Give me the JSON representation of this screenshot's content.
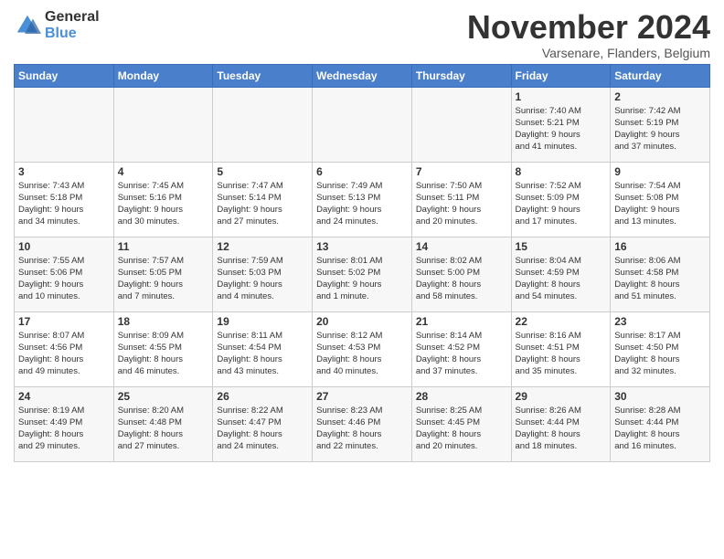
{
  "header": {
    "logo_general": "General",
    "logo_blue": "Blue",
    "title": "November 2024",
    "location": "Varsenare, Flanders, Belgium"
  },
  "days_of_week": [
    "Sunday",
    "Monday",
    "Tuesday",
    "Wednesday",
    "Thursday",
    "Friday",
    "Saturday"
  ],
  "weeks": [
    [
      {
        "day": "",
        "info": ""
      },
      {
        "day": "",
        "info": ""
      },
      {
        "day": "",
        "info": ""
      },
      {
        "day": "",
        "info": ""
      },
      {
        "day": "",
        "info": ""
      },
      {
        "day": "1",
        "info": "Sunrise: 7:40 AM\nSunset: 5:21 PM\nDaylight: 9 hours\nand 41 minutes."
      },
      {
        "day": "2",
        "info": "Sunrise: 7:42 AM\nSunset: 5:19 PM\nDaylight: 9 hours\nand 37 minutes."
      }
    ],
    [
      {
        "day": "3",
        "info": "Sunrise: 7:43 AM\nSunset: 5:18 PM\nDaylight: 9 hours\nand 34 minutes."
      },
      {
        "day": "4",
        "info": "Sunrise: 7:45 AM\nSunset: 5:16 PM\nDaylight: 9 hours\nand 30 minutes."
      },
      {
        "day": "5",
        "info": "Sunrise: 7:47 AM\nSunset: 5:14 PM\nDaylight: 9 hours\nand 27 minutes."
      },
      {
        "day": "6",
        "info": "Sunrise: 7:49 AM\nSunset: 5:13 PM\nDaylight: 9 hours\nand 24 minutes."
      },
      {
        "day": "7",
        "info": "Sunrise: 7:50 AM\nSunset: 5:11 PM\nDaylight: 9 hours\nand 20 minutes."
      },
      {
        "day": "8",
        "info": "Sunrise: 7:52 AM\nSunset: 5:09 PM\nDaylight: 9 hours\nand 17 minutes."
      },
      {
        "day": "9",
        "info": "Sunrise: 7:54 AM\nSunset: 5:08 PM\nDaylight: 9 hours\nand 13 minutes."
      }
    ],
    [
      {
        "day": "10",
        "info": "Sunrise: 7:55 AM\nSunset: 5:06 PM\nDaylight: 9 hours\nand 10 minutes."
      },
      {
        "day": "11",
        "info": "Sunrise: 7:57 AM\nSunset: 5:05 PM\nDaylight: 9 hours\nand 7 minutes."
      },
      {
        "day": "12",
        "info": "Sunrise: 7:59 AM\nSunset: 5:03 PM\nDaylight: 9 hours\nand 4 minutes."
      },
      {
        "day": "13",
        "info": "Sunrise: 8:01 AM\nSunset: 5:02 PM\nDaylight: 9 hours\nand 1 minute."
      },
      {
        "day": "14",
        "info": "Sunrise: 8:02 AM\nSunset: 5:00 PM\nDaylight: 8 hours\nand 58 minutes."
      },
      {
        "day": "15",
        "info": "Sunrise: 8:04 AM\nSunset: 4:59 PM\nDaylight: 8 hours\nand 54 minutes."
      },
      {
        "day": "16",
        "info": "Sunrise: 8:06 AM\nSunset: 4:58 PM\nDaylight: 8 hours\nand 51 minutes."
      }
    ],
    [
      {
        "day": "17",
        "info": "Sunrise: 8:07 AM\nSunset: 4:56 PM\nDaylight: 8 hours\nand 49 minutes."
      },
      {
        "day": "18",
        "info": "Sunrise: 8:09 AM\nSunset: 4:55 PM\nDaylight: 8 hours\nand 46 minutes."
      },
      {
        "day": "19",
        "info": "Sunrise: 8:11 AM\nSunset: 4:54 PM\nDaylight: 8 hours\nand 43 minutes."
      },
      {
        "day": "20",
        "info": "Sunrise: 8:12 AM\nSunset: 4:53 PM\nDaylight: 8 hours\nand 40 minutes."
      },
      {
        "day": "21",
        "info": "Sunrise: 8:14 AM\nSunset: 4:52 PM\nDaylight: 8 hours\nand 37 minutes."
      },
      {
        "day": "22",
        "info": "Sunrise: 8:16 AM\nSunset: 4:51 PM\nDaylight: 8 hours\nand 35 minutes."
      },
      {
        "day": "23",
        "info": "Sunrise: 8:17 AM\nSunset: 4:50 PM\nDaylight: 8 hours\nand 32 minutes."
      }
    ],
    [
      {
        "day": "24",
        "info": "Sunrise: 8:19 AM\nSunset: 4:49 PM\nDaylight: 8 hours\nand 29 minutes."
      },
      {
        "day": "25",
        "info": "Sunrise: 8:20 AM\nSunset: 4:48 PM\nDaylight: 8 hours\nand 27 minutes."
      },
      {
        "day": "26",
        "info": "Sunrise: 8:22 AM\nSunset: 4:47 PM\nDaylight: 8 hours\nand 24 minutes."
      },
      {
        "day": "27",
        "info": "Sunrise: 8:23 AM\nSunset: 4:46 PM\nDaylight: 8 hours\nand 22 minutes."
      },
      {
        "day": "28",
        "info": "Sunrise: 8:25 AM\nSunset: 4:45 PM\nDaylight: 8 hours\nand 20 minutes."
      },
      {
        "day": "29",
        "info": "Sunrise: 8:26 AM\nSunset: 4:44 PM\nDaylight: 8 hours\nand 18 minutes."
      },
      {
        "day": "30",
        "info": "Sunrise: 8:28 AM\nSunset: 4:44 PM\nDaylight: 8 hours\nand 16 minutes."
      }
    ]
  ]
}
